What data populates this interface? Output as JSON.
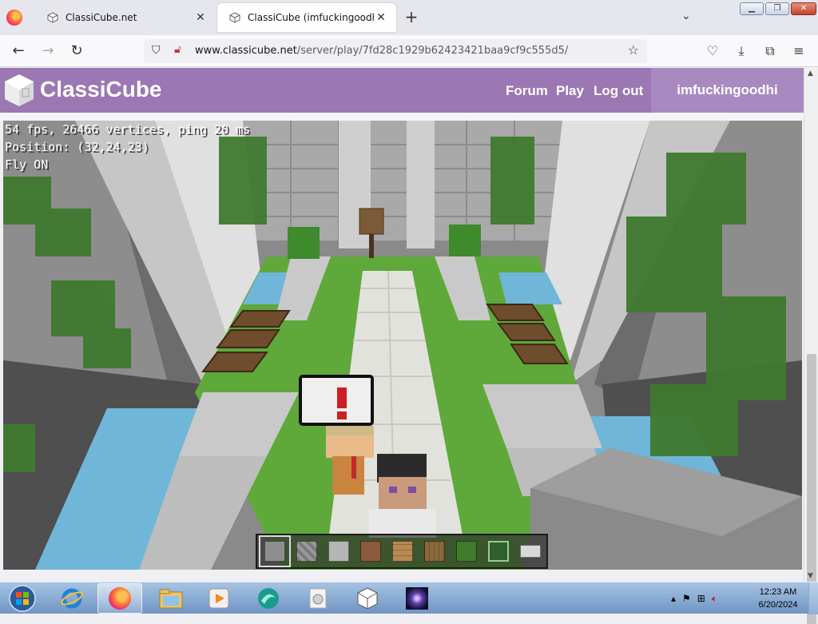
{
  "browser": {
    "tabs": [
      {
        "title": "ClassiCube.net",
        "active": false
      },
      {
        "title": "ClassiCube (imfuckingoodhi)",
        "active": true
      }
    ],
    "url_domain": "www.classicube.net",
    "url_path": "/server/play/7fd28c1929b62423421baa9cf9c555d5/"
  },
  "site": {
    "title": "ClassiCube",
    "nav": [
      "Forum",
      "Play",
      "Log out"
    ],
    "username": "imfuckingoodhi",
    "header_color": "#9b77b3"
  },
  "game": {
    "hud_lines": [
      "54 fps, 26466 vertices, ping 20 ms",
      "Position: (32,24,23)",
      "Fly ON"
    ],
    "hotbar": {
      "selected_index": 0,
      "slots": [
        {
          "name": "stone",
          "color": "#8e8e8e"
        },
        {
          "name": "cobblestone",
          "color": "#7a7a7a"
        },
        {
          "name": "smooth-stone",
          "color": "#b5b5b5"
        },
        {
          "name": "dirt",
          "color": "#8b5a3c"
        },
        {
          "name": "wood-planks",
          "color": "#b68a52"
        },
        {
          "name": "log",
          "color": "#8a6a3b"
        },
        {
          "name": "leaves",
          "color": "#3f7d2a"
        },
        {
          "name": "glass",
          "color": "#2f5f2f"
        },
        {
          "name": "white-stone",
          "color": "#d8d8d8"
        }
      ]
    }
  },
  "taskbar": {
    "time": "12:23 AM",
    "date": "6/20/2024"
  }
}
